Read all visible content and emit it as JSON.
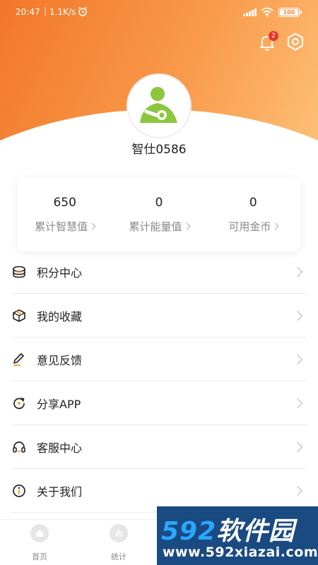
{
  "status_bar": {
    "time": "20:47",
    "separator": "|",
    "net_speed": "1.1K/s",
    "battery_level": "100"
  },
  "notifications": {
    "badge_count": "2"
  },
  "profile": {
    "username": "智仕0586"
  },
  "stats": [
    {
      "value": "650",
      "label": "累计智慧值"
    },
    {
      "value": "0",
      "label": "累计能量值"
    },
    {
      "value": "0",
      "label": "可用金币"
    }
  ],
  "menu": [
    {
      "label": "积分中心",
      "icon": "coin-stack-icon"
    },
    {
      "label": "我的收藏",
      "icon": "box-icon"
    },
    {
      "label": "意见反馈",
      "icon": "pencil-icon"
    },
    {
      "label": "分享APP",
      "icon": "share-refresh-icon"
    },
    {
      "label": "客服中心",
      "icon": "headset-icon"
    },
    {
      "label": "关于我们",
      "icon": "info-icon"
    }
  ],
  "tabs": [
    {
      "label": "首页",
      "icon": "home-icon"
    },
    {
      "label": "统计",
      "icon": "stats-icon"
    },
    {
      "label": "",
      "icon": "tab-icon"
    },
    {
      "label": "",
      "icon": "tab-icon"
    }
  ],
  "watermark": {
    "logo_digits": "592",
    "logo_text": "软件园",
    "url": "www.592xiazai.com"
  },
  "colors": {
    "header_start": "#f2772a",
    "header_end": "#fec27a",
    "avatar_green": "#8dc63f",
    "badge_red": "#e8352a",
    "accent_orange": "#f5a623"
  }
}
